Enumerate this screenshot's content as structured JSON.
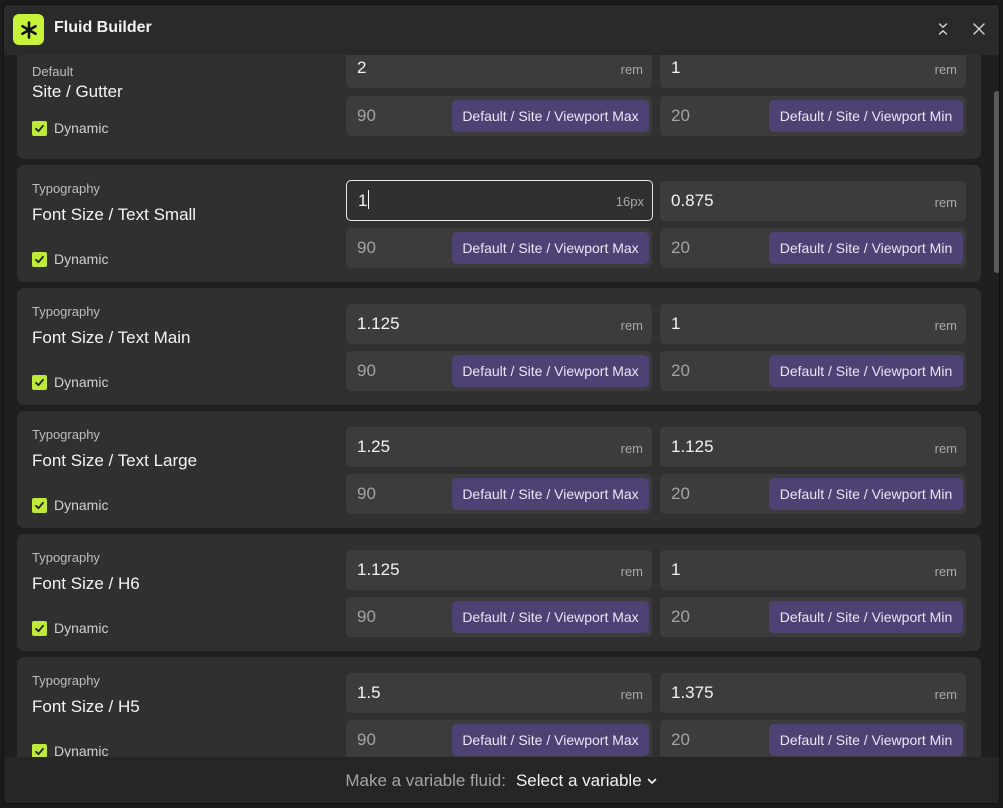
{
  "window": {
    "title": "Fluid Builder",
    "accent_color": "#c7f33a",
    "button_color": "#4d4273"
  },
  "rows": [
    {
      "category": "Default",
      "name": "Site / Gutter",
      "dynamic_label": "Dynamic",
      "max_value": "2",
      "max_unit": "rem",
      "min_value": "1",
      "min_unit": "rem",
      "max_viewport": "90",
      "max_viewport_var": "Default / Site / Viewport Max",
      "min_viewport": "20",
      "min_viewport_var": "Default / Site / Viewport Min"
    },
    {
      "category": "Typography",
      "name": "Font Size / Text Small",
      "dynamic_label": "Dynamic",
      "max_value": "1",
      "max_unit": "16px",
      "min_value": "0.875",
      "min_unit": "rem",
      "max_viewport": "90",
      "max_viewport_var": "Default / Site / Viewport Max",
      "min_viewport": "20",
      "min_viewport_var": "Default / Site / Viewport Min"
    },
    {
      "category": "Typography",
      "name": "Font Size / Text Main",
      "dynamic_label": "Dynamic",
      "max_value": "1.125",
      "max_unit": "rem",
      "min_value": "1",
      "min_unit": "rem",
      "max_viewport": "90",
      "max_viewport_var": "Default / Site / Viewport Max",
      "min_viewport": "20",
      "min_viewport_var": "Default / Site / Viewport Min"
    },
    {
      "category": "Typography",
      "name": "Font Size / Text Large",
      "dynamic_label": "Dynamic",
      "max_value": "1.25",
      "max_unit": "rem",
      "min_value": "1.125",
      "min_unit": "rem",
      "max_viewport": "90",
      "max_viewport_var": "Default / Site / Viewport Max",
      "min_viewport": "20",
      "min_viewport_var": "Default / Site / Viewport Min"
    },
    {
      "category": "Typography",
      "name": "Font Size / H6",
      "dynamic_label": "Dynamic",
      "max_value": "1.125",
      "max_unit": "rem",
      "min_value": "1",
      "min_unit": "rem",
      "max_viewport": "90",
      "max_viewport_var": "Default / Site / Viewport Max",
      "min_viewport": "20",
      "min_viewport_var": "Default / Site / Viewport Min"
    },
    {
      "category": "Typography",
      "name": "Font Size / H5",
      "dynamic_label": "Dynamic",
      "max_value": "1.5",
      "max_unit": "rem",
      "min_value": "1.375",
      "min_unit": "rem",
      "max_viewport": "90",
      "max_viewport_var": "Default / Site / Viewport Max",
      "min_viewport": "20",
      "min_viewport_var": "Default / Site / Viewport Min"
    }
  ],
  "footer": {
    "label": "Make a variable fluid:",
    "select_value": "Select a variable"
  }
}
